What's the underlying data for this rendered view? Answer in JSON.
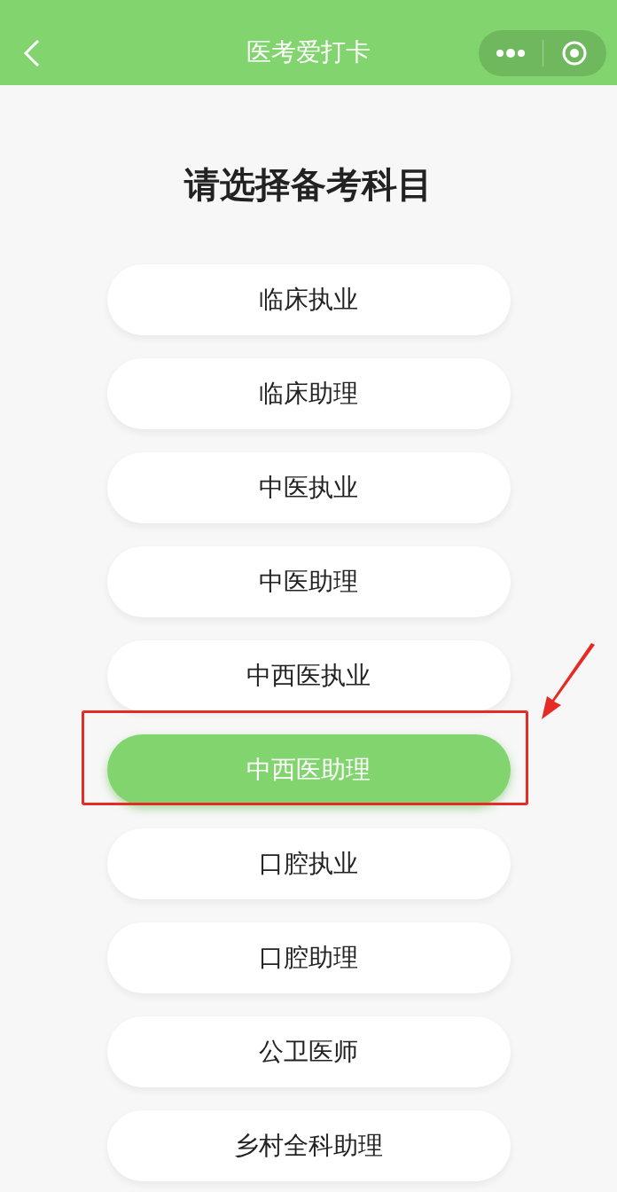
{
  "header": {
    "title": "医考爱打卡"
  },
  "heading": "请选择备考科目",
  "options": [
    {
      "label": "临床执业",
      "selected": false,
      "highlighted": false
    },
    {
      "label": "临床助理",
      "selected": false,
      "highlighted": false
    },
    {
      "label": "中医执业",
      "selected": false,
      "highlighted": false
    },
    {
      "label": "中医助理",
      "selected": false,
      "highlighted": false
    },
    {
      "label": "中西医执业",
      "selected": false,
      "highlighted": false
    },
    {
      "label": "中西医助理",
      "selected": true,
      "highlighted": true
    },
    {
      "label": "口腔执业",
      "selected": false,
      "highlighted": false
    },
    {
      "label": "口腔助理",
      "selected": false,
      "highlighted": false
    },
    {
      "label": "公卫医师",
      "selected": false,
      "highlighted": false
    },
    {
      "label": "乡村全科助理",
      "selected": false,
      "highlighted": false
    }
  ]
}
